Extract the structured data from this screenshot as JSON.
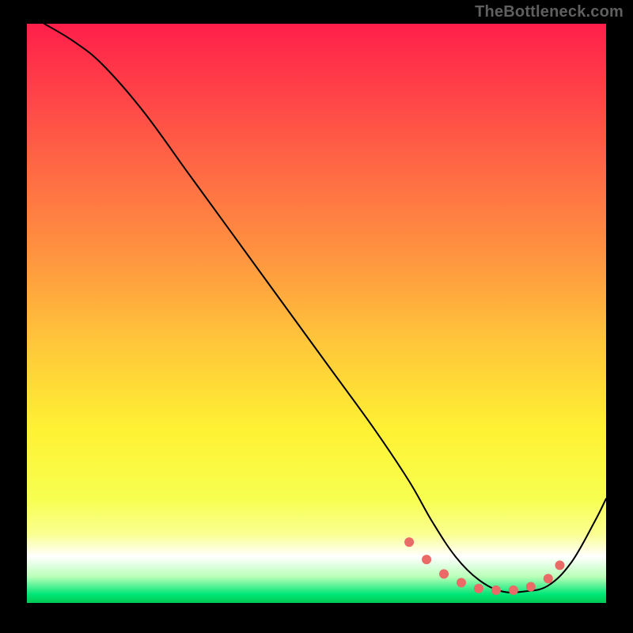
{
  "watermark": {
    "text": "TheBottleneck.com"
  },
  "colors": {
    "black": "#000000",
    "bead": "#ea6a67",
    "gradient_stops": [
      {
        "offset": 0.0,
        "color": "#ff1f4a"
      },
      {
        "offset": 0.2,
        "color": "#ff5a46"
      },
      {
        "offset": 0.4,
        "color": "#ff9440"
      },
      {
        "offset": 0.55,
        "color": "#ffc63a"
      },
      {
        "offset": 0.7,
        "color": "#fff133"
      },
      {
        "offset": 0.82,
        "color": "#f7ff4f"
      },
      {
        "offset": 0.88,
        "color": "#faff8f"
      },
      {
        "offset": 0.92,
        "color": "#ffffff"
      },
      {
        "offset": 0.955,
        "color": "#b8ffb8"
      },
      {
        "offset": 0.985,
        "color": "#00e676"
      },
      {
        "offset": 1.0,
        "color": "#00c853"
      }
    ]
  },
  "chart_data": {
    "type": "line",
    "title": "",
    "xlabel": "",
    "ylabel": "",
    "xlim": [
      0,
      100
    ],
    "ylim": [
      0,
      100
    ],
    "grid": false,
    "note": "Axis units are percent of plot area. y = curve height where 0 = bottom, 100 = top.",
    "series": [
      {
        "name": "bottleneck-curve",
        "x": [
          3,
          8,
          13,
          20,
          28,
          36,
          44,
          52,
          60,
          66,
          70,
          74,
          78,
          82,
          86,
          90,
          94,
          98,
          100
        ],
        "y": [
          100,
          97,
          93,
          85,
          74,
          63,
          52,
          41,
          30,
          21,
          14,
          8,
          4,
          2,
          2,
          3,
          7,
          14,
          18
        ]
      }
    ],
    "highlight": {
      "name": "optimal-zone-beads",
      "x": [
        66,
        69,
        72,
        75,
        78,
        81,
        84,
        87,
        90,
        92
      ],
      "y": [
        10.5,
        7.5,
        5,
        3.5,
        2.5,
        2.2,
        2.2,
        2.8,
        4.2,
        6.5
      ]
    }
  }
}
